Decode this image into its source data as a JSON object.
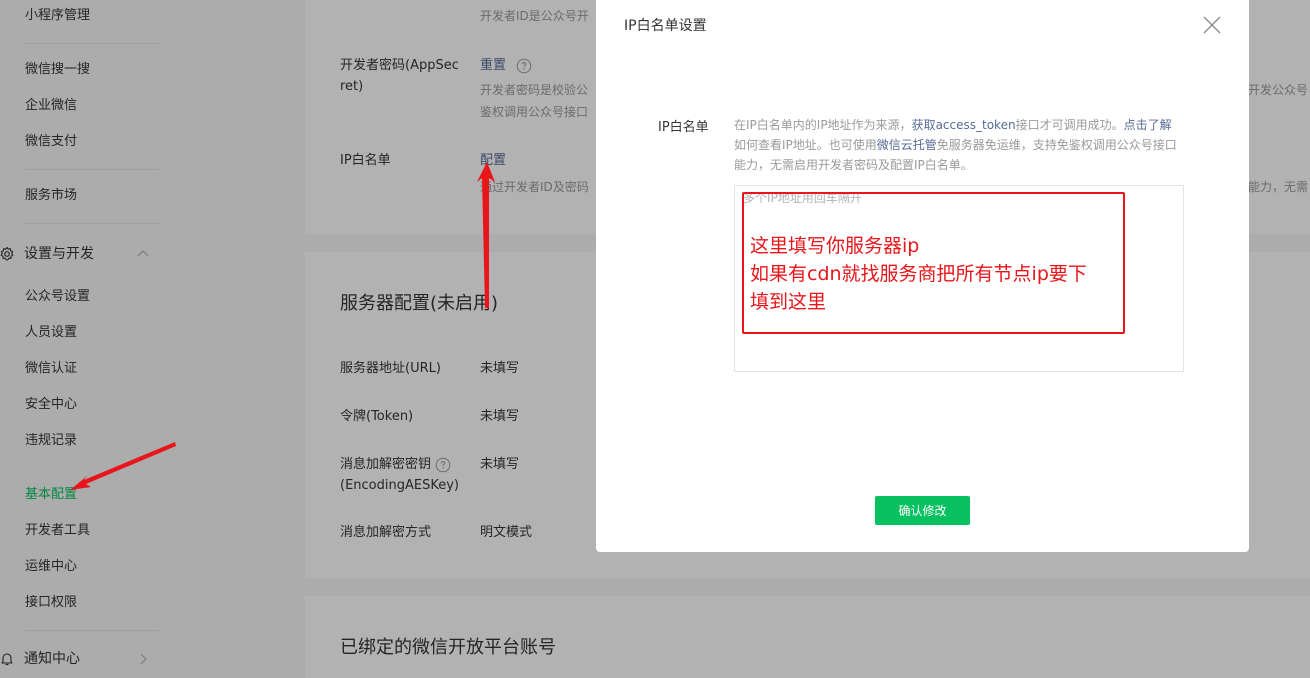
{
  "sidebar": {
    "items": [
      {
        "label": "小程序管理"
      },
      {
        "label": "微信搜一搜"
      },
      {
        "label": "企业微信"
      },
      {
        "label": "微信支付"
      },
      {
        "label": "服务市场"
      }
    ],
    "group_settings": {
      "label": "设置与开发",
      "icon": "gear-icon",
      "chevron": "chevron-up-icon"
    },
    "settings_items": [
      {
        "label": "公众号设置"
      },
      {
        "label": "人员设置"
      },
      {
        "label": "微信认证"
      },
      {
        "label": "安全中心"
      },
      {
        "label": "违规记录"
      },
      {
        "label": "基本配置",
        "active": true
      },
      {
        "label": "开发者工具"
      },
      {
        "label": "运维中心"
      },
      {
        "label": "接口权限"
      }
    ],
    "group_notify": {
      "label": "通知中心",
      "icon": "bell-icon",
      "chevron": "chevron-right-icon"
    }
  },
  "main": {
    "dev_id_desc": "开发者ID是公众号开",
    "app_secret": {
      "label_line1": "开发者密码(AppSec",
      "label_line2": "ret)",
      "action": "重置",
      "desc_line1": "开发者密码是校验公",
      "desc_line2": "鉴权调用公众号接口",
      "right_fragment": "开发公众号"
    },
    "ip_whitelist": {
      "label": "IP白名单",
      "action": "配置",
      "desc": "通过开发者ID及密码",
      "right_fragment": "能力，无需"
    },
    "server_config": {
      "title": "服务器配置(未启用)",
      "rows": [
        {
          "label": "服务器地址(URL)",
          "value": "未填写"
        },
        {
          "label": "令牌(Token)",
          "value": "未填写"
        },
        {
          "label_line1": "消息加解密密钥",
          "label_line2": "(EncodingAESKey)",
          "value": "未填写"
        },
        {
          "label": "消息加解密方式",
          "value": "明文模式"
        }
      ]
    },
    "bound_title": "已绑定的微信开放平台账号"
  },
  "modal": {
    "title": "IP白名单设置",
    "field_label": "IP白名单",
    "desc": {
      "p1": "在IP白名单内的IP地址作为来源，",
      "l1": "获取access_token",
      "p2": "接口才可调用成功。",
      "l2": "点击了解",
      "p3": "如何查看IP地址。也可使用",
      "l3": "微信云托管",
      "p4": "免服务器免运维，支持免鉴权调用公众号接口能力，无需启用开发者密码及配置IP白名单。"
    },
    "placeholder": "多个IP地址用回车隔开",
    "annotation": {
      "line1": "这里填写你服务器ip",
      "line2": "如果有cdn就找服务商把所有节点ip要下",
      "line3": "填到这里"
    },
    "confirm": "确认修改"
  },
  "colors": {
    "accent": "#07c160",
    "link": "#576b95",
    "annotation": "#e8161a"
  }
}
